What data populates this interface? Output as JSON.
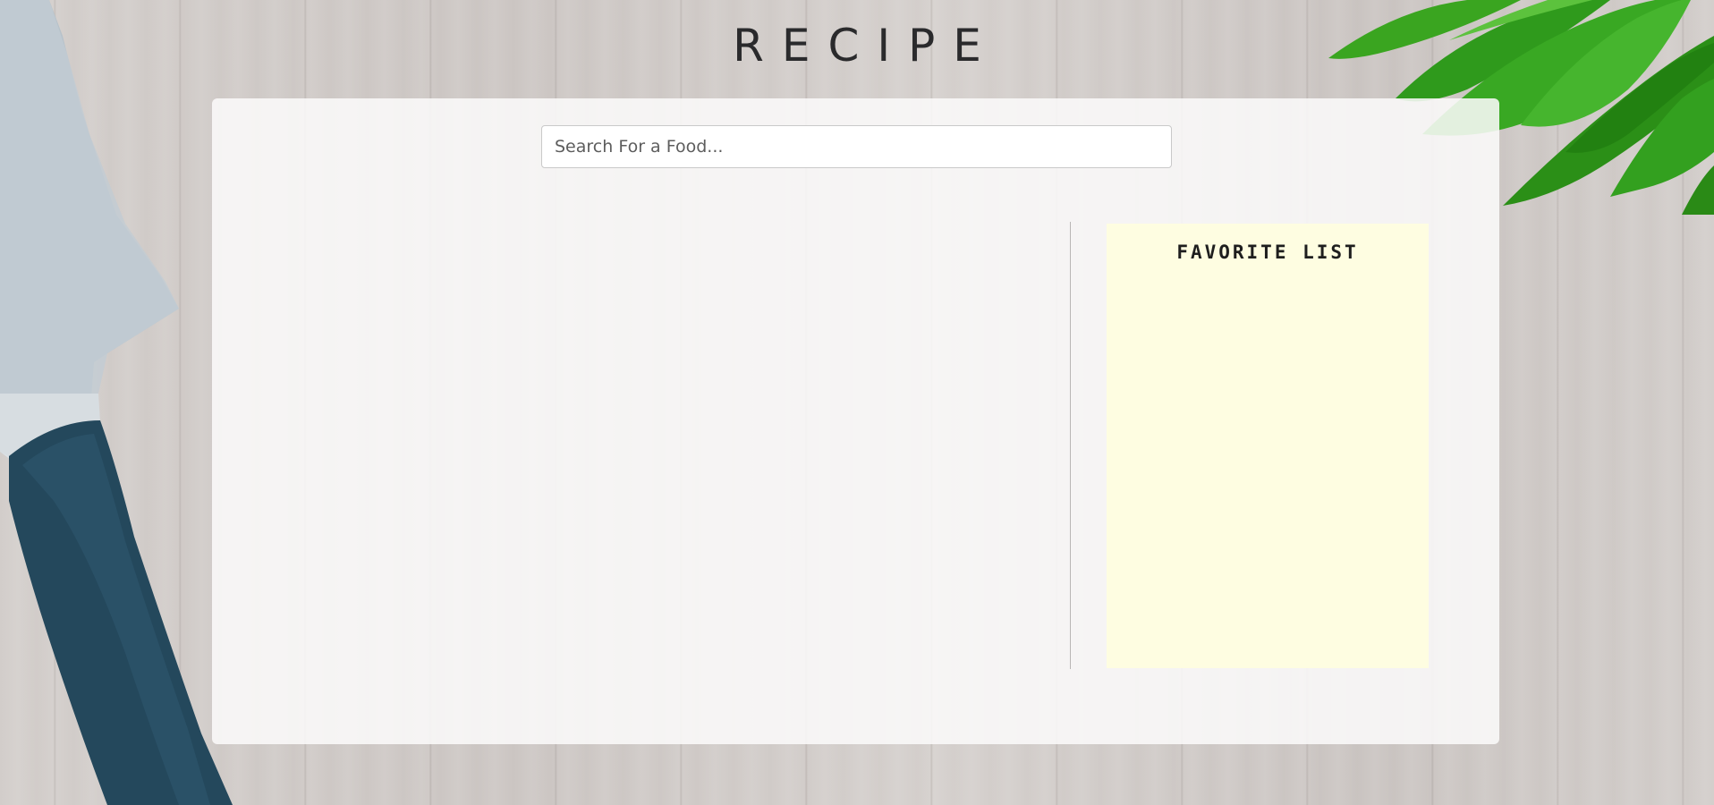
{
  "header": {
    "title": "RECIPE"
  },
  "search": {
    "placeholder": "Search For a Food...",
    "value": ""
  },
  "favorites": {
    "title": "FAVORITE LIST",
    "items": []
  },
  "background": {
    "decor": [
      "knife",
      "basil-leaves"
    ],
    "colors": {
      "wood": "#cfc9c6",
      "knife_handle": "#24485c",
      "knife_blade": "#b9c3cb",
      "leaves": "#2f9a1c",
      "panel": "#fefde1"
    }
  }
}
